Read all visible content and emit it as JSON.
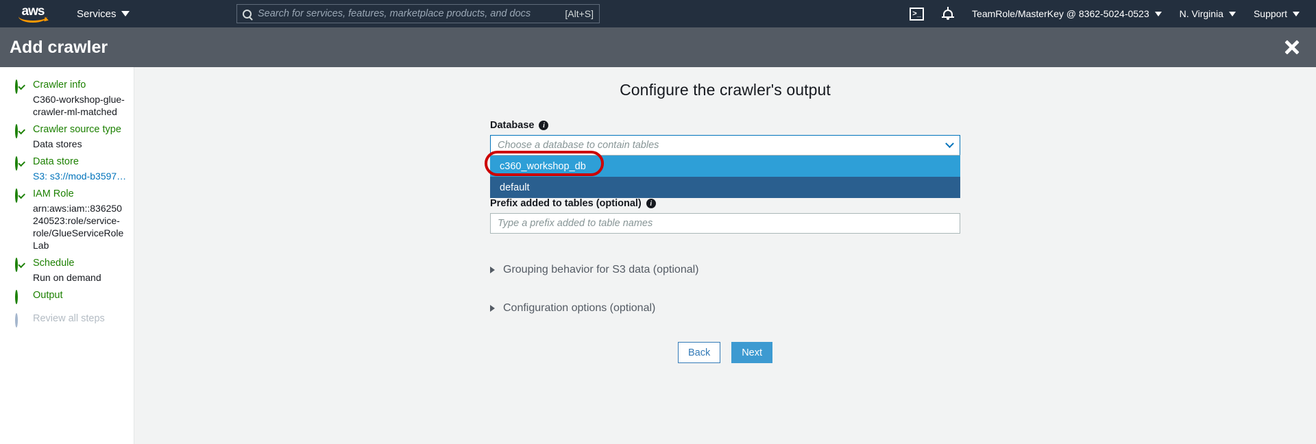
{
  "topnav": {
    "logo_text": "aws",
    "services_label": "Services",
    "search_placeholder": "Search for services, features, marketplace products, and docs",
    "search_shortcut": "[Alt+S]",
    "cloudshell_icon": "cloudshell-icon",
    "notifications_icon": "bell-icon",
    "account_label": "TeamRole/MasterKey @ 8362-5024-0523",
    "region_label": "N. Virginia",
    "support_label": "Support",
    "background_color": "#232f3e"
  },
  "header": {
    "title": "Add crawler",
    "close_icon": "close-icon",
    "background_color": "#545b64"
  },
  "sidebar": {
    "steps": [
      {
        "label": "Crawler info",
        "state": "done",
        "detail": "C360-workshop-glue-crawler-ml-matched",
        "detail_is_link": false
      },
      {
        "label": "Crawler source type",
        "state": "done",
        "detail": "Data stores",
        "detail_is_link": false
      },
      {
        "label": "Data store",
        "state": "done",
        "detail": "S3: s3://mod-b3597…",
        "detail_is_link": true
      },
      {
        "label": "IAM Role",
        "state": "done",
        "detail": "arn:aws:iam::836250240523:role/service-role/GlueServiceRoleLab",
        "detail_is_link": false
      },
      {
        "label": "Schedule",
        "state": "done",
        "detail": "Run on demand",
        "detail_is_link": false
      },
      {
        "label": "Output",
        "state": "current",
        "detail": "",
        "detail_is_link": false
      },
      {
        "label": "Review all steps",
        "state": "future",
        "detail": "",
        "detail_is_link": false
      }
    ],
    "done_color": "#1d8102",
    "future_color": "#b4bcc4"
  },
  "main": {
    "page_title": "Configure the crawler's output",
    "database": {
      "label": "Database",
      "info_icon": "info-icon",
      "placeholder": "Choose a database to contain tables",
      "chevron_icon": "chevron-down-icon",
      "options": [
        {
          "label": "c360_workshop_db",
          "highlight": "hover"
        },
        {
          "label": "default",
          "highlight": "selected"
        }
      ],
      "highlight_color": "#2e9fd7",
      "selected_color": "#2a5f8f",
      "annotation_color": "#cc0000"
    },
    "prefix": {
      "label": "Prefix added to tables (optional)",
      "info_icon": "info-icon",
      "placeholder": "Type a prefix added to table names",
      "value": ""
    },
    "sections": [
      {
        "label": "Grouping behavior for S3 data (optional)",
        "icon": "triangle-right-icon"
      },
      {
        "label": "Configuration options (optional)",
        "icon": "triangle-right-icon"
      }
    ],
    "buttons": {
      "back_label": "Back",
      "next_label": "Next",
      "primary_color": "#3d9ad1"
    }
  }
}
